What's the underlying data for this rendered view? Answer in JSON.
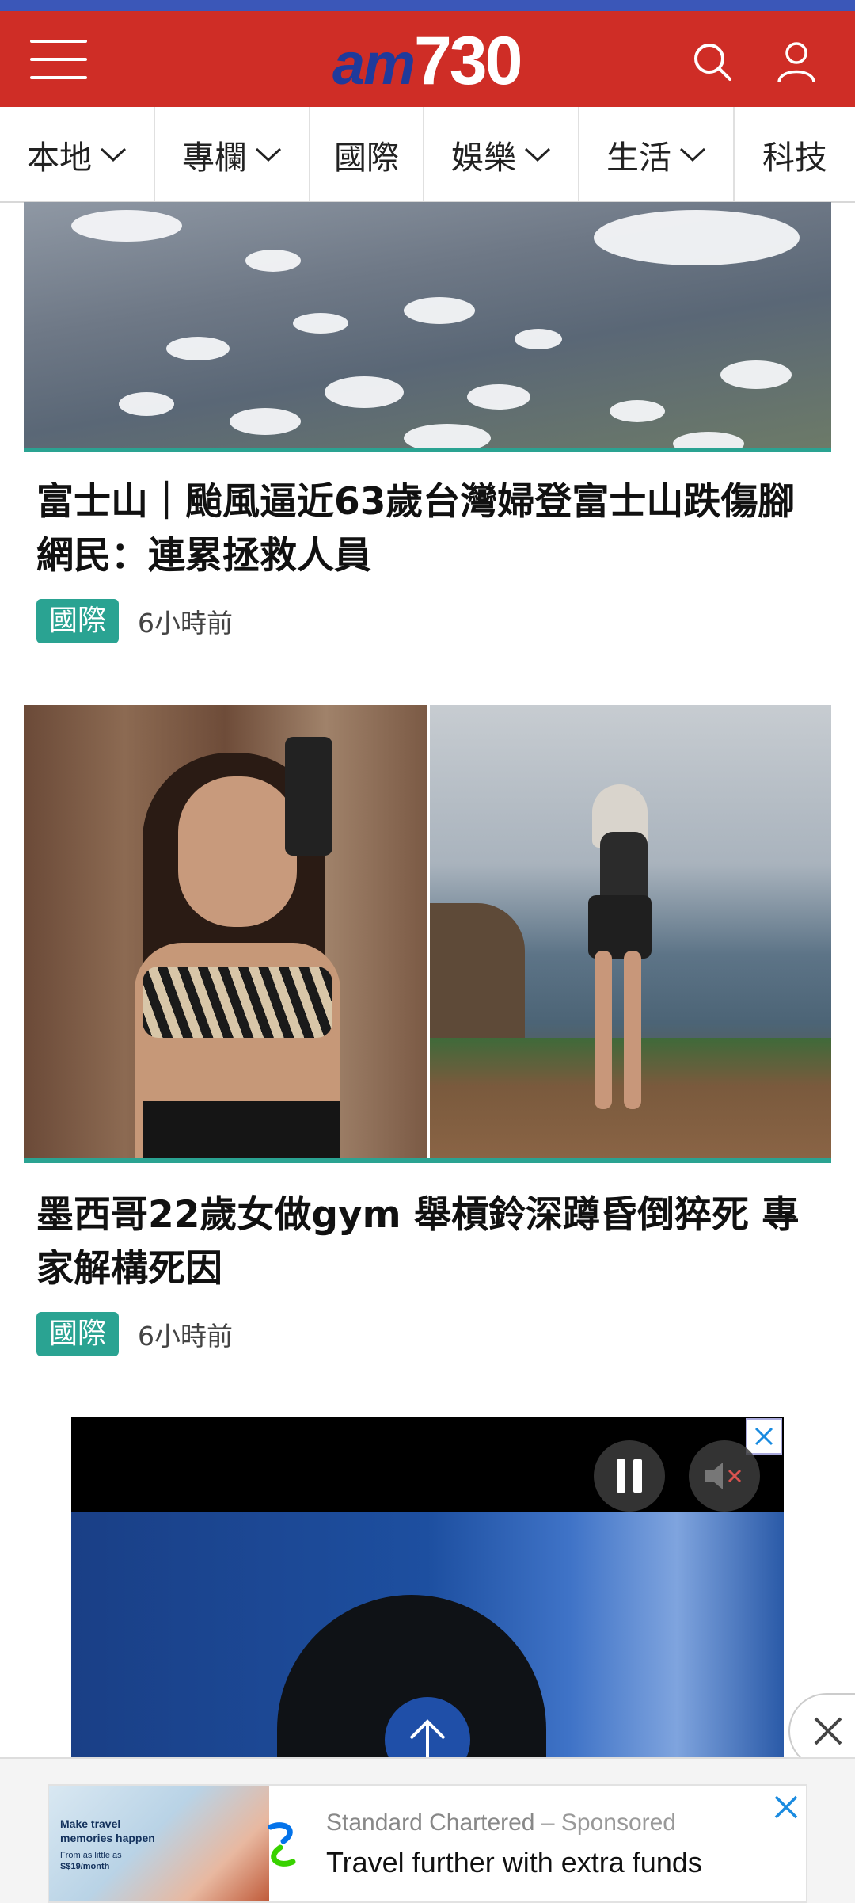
{
  "header": {
    "logo_prefix": "am",
    "logo_number": "730",
    "brand_color": "#cf2d26"
  },
  "nav": {
    "items": [
      {
        "label": "本地",
        "has_dropdown": true
      },
      {
        "label": "專欄",
        "has_dropdown": true
      },
      {
        "label": "國際",
        "has_dropdown": false
      },
      {
        "label": "娛樂",
        "has_dropdown": true
      },
      {
        "label": "生活",
        "has_dropdown": true
      },
      {
        "label": "科技",
        "has_dropdown": false
      }
    ]
  },
  "articles": [
    {
      "headline": "富士山｜颱風逼近63歲台灣婦登富士山跌傷腳 網民：連累拯救人員",
      "category": "國際",
      "time": "6小時前"
    },
    {
      "headline": "墨西哥22歲女做gym 舉槓鈴深蹲昏倒猝死 專家解構死因",
      "category": "國際",
      "time": "6小時前"
    }
  ],
  "bottom_ad": {
    "advertiser": "Standard Chartered",
    "separator": "–",
    "sponsored": "Sponsored",
    "title": "Travel further with extra funds",
    "image_text": [
      "Make travel",
      "memories happen",
      "From as little as",
      "S$19/month"
    ]
  },
  "colors": {
    "accent_teal": "#2aa392",
    "nav_border": "#e0e0e0",
    "scroll_top": "#1f4fa8"
  }
}
